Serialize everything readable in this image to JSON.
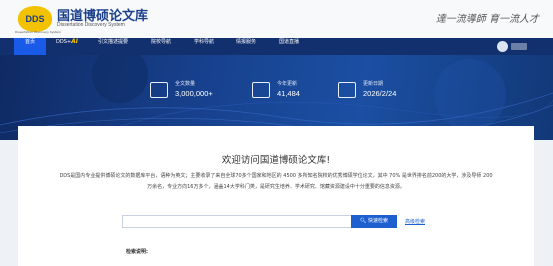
{
  "header": {
    "logo_text": "DDS",
    "logo_subtext": "Dissertation Discovery System",
    "title": "国道博硕论文库",
    "subtitle": "Dissertation Discovery System",
    "slogan": "達一流導師 育一流人才"
  },
  "nav": {
    "items": [
      {
        "label": "首页",
        "active": true
      },
      {
        "label": "DDS+",
        "suffix": "AI"
      },
      {
        "label": "引文描述提要"
      },
      {
        "label": "院校导航"
      },
      {
        "label": "学科导航"
      },
      {
        "label": "情报服务"
      },
      {
        "label": "国道直播"
      }
    ]
  },
  "stats": [
    {
      "icon": "chart-icon",
      "label": "全文数量",
      "value": "3,000,000+"
    },
    {
      "icon": "calendar-icon",
      "label": "今年更新",
      "value": "41,484"
    },
    {
      "icon": "upload-icon",
      "label": "更新日期",
      "value": "2026/2/24"
    }
  ],
  "main": {
    "welcome": "欢迎访问国道博硕论文库!",
    "intro": "DDS是国内专业提供博硕论文的数据库平台，语种为英文；主要收录了来自全球70多个国家和地区的 4500 多所知名院校的优秀博硕学位论文，其中 70% 是世界排名前200的大学，涉及导师 200万余名，专业方向16万多个，涵盖14大学科门类，是研究生培养、学术研究、馆藏资源建设中十分重要的信息资源。",
    "search": {
      "placeholder": "",
      "button_label": "快速检索",
      "advanced_label": "高级检索"
    },
    "tips_label": "检索说明:"
  },
  "colors": {
    "nav_bg": "#12306e",
    "accent": "#1e5fd0",
    "logo_yellow": "#f2c200"
  }
}
